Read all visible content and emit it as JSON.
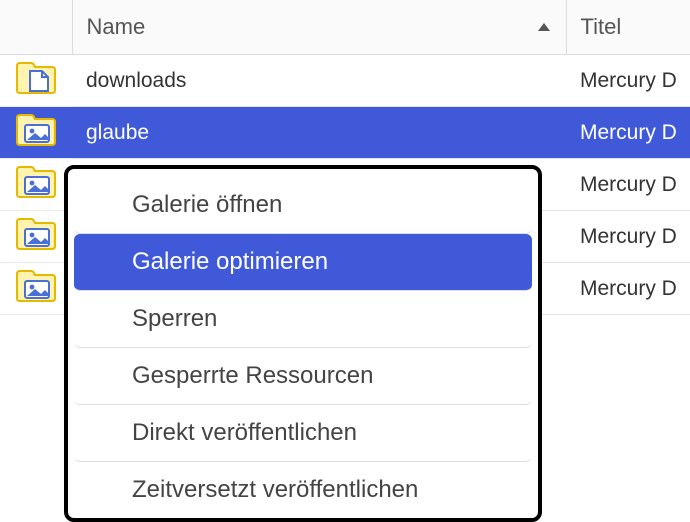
{
  "columns": {
    "name": "Name",
    "titel": "Titel"
  },
  "rows": [
    {
      "kind": "folder-doc",
      "name": "downloads",
      "titel": "Mercury D",
      "selected": false
    },
    {
      "kind": "folder-img",
      "name": "glaube",
      "titel": "Mercury D",
      "selected": true
    },
    {
      "kind": "folder-img",
      "name": "",
      "titel": "Mercury D",
      "selected": false
    },
    {
      "kind": "folder-img",
      "name": "",
      "titel": "Mercury D",
      "selected": false
    },
    {
      "kind": "folder-img",
      "name": "",
      "titel": "Mercury D",
      "selected": false
    }
  ],
  "context_menu": {
    "hover_index": 1,
    "items": [
      "Galerie öffnen",
      "Galerie optimieren",
      "Sperren",
      "Gesperrte Ressourcen",
      "Direkt veröffentlichen",
      "Zeitversetzt veröffentlichen"
    ]
  }
}
